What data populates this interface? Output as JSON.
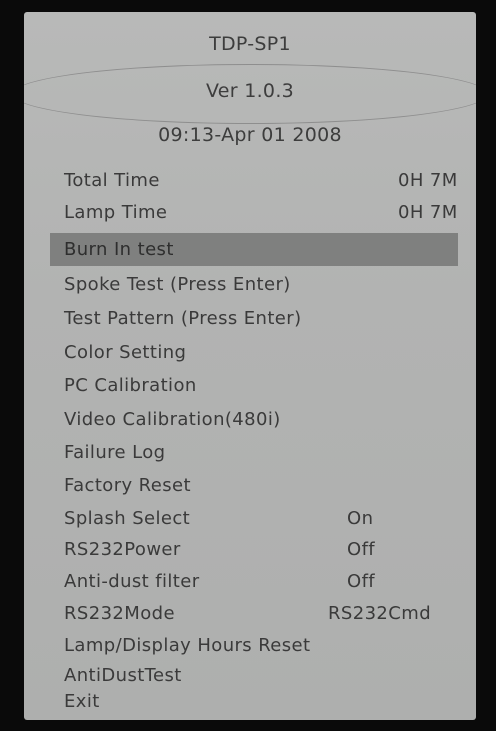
{
  "header": {
    "model": "TDP-SP1",
    "version": "Ver 1.0.3",
    "datetime": "09:13-Apr 01 2008"
  },
  "menu": {
    "items": [
      {
        "label": "Total Time",
        "value": "0H 7M"
      },
      {
        "label": "Lamp Time",
        "value": "0H 7M"
      },
      {
        "label": "Burn In test",
        "value": ""
      },
      {
        "label": "Spoke Test (Press Enter)",
        "value": ""
      },
      {
        "label": "Test Pattern (Press Enter)",
        "value": ""
      },
      {
        "label": "Color Setting",
        "value": ""
      },
      {
        "label": "PC Calibration",
        "value": ""
      },
      {
        "label": "Video Calibration(480i)",
        "value": ""
      },
      {
        "label": "Failure Log",
        "value": ""
      },
      {
        "label": "Factory Reset",
        "value": ""
      },
      {
        "label": "Splash Select",
        "value": "On"
      },
      {
        "label": "RS232Power",
        "value": "Off"
      },
      {
        "label": "Anti-dust filter",
        "value": "Off"
      },
      {
        "label": "RS232Mode",
        "value": "RS232Cmd"
      },
      {
        "label": "Lamp/Display Hours Reset",
        "value": ""
      },
      {
        "label": "AntiDustTest",
        "value": ""
      },
      {
        "label": "Exit",
        "value": ""
      }
    ],
    "selected_index": 2
  },
  "colors": {
    "panel": "#b4b5b4",
    "highlight": "#7f807f",
    "text": "#3a3a3a",
    "bezel": "#0a0a0a"
  }
}
